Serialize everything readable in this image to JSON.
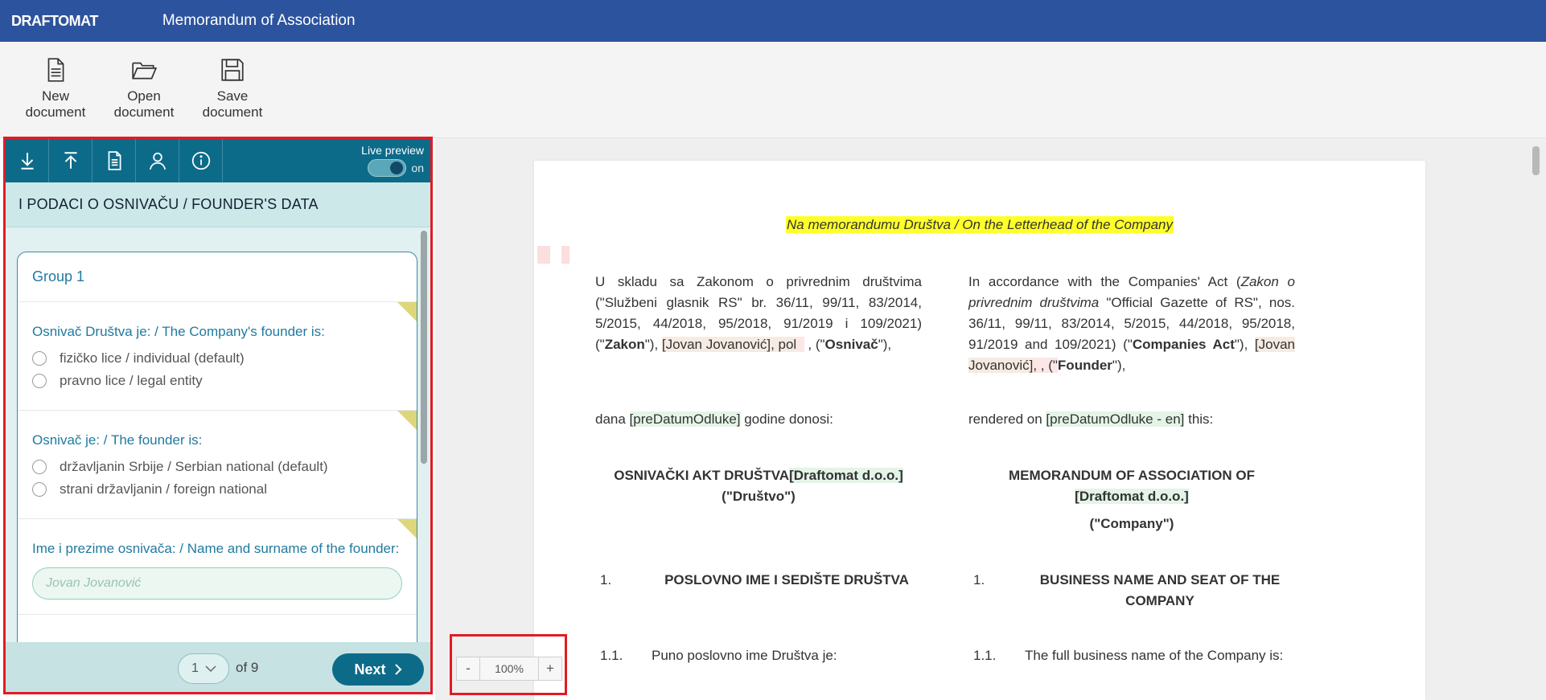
{
  "app": {
    "logo": "DRAFTOMAT",
    "title": "Memorandum of Association"
  },
  "toolbar": {
    "new_label": "New\ndocument",
    "open_label": "Open\ndocument",
    "save_label": "Save\ndocument"
  },
  "panel": {
    "tools": [
      "download-icon",
      "upload-icon",
      "document-icon",
      "user-icon",
      "info-icon"
    ],
    "live_preview_label": "Live preview",
    "live_preview_state": "on",
    "section_title": "I PODACI O OSNIVAČU / FOUNDER'S DATA",
    "group_title": "Group 1",
    "q1": {
      "label": "Osnivač Društva je: / The Company's founder is:",
      "options": [
        "fizičko lice / individual (default)",
        "pravno lice / legal entity"
      ]
    },
    "q2": {
      "label": "Osnivač je: / The founder is:",
      "options": [
        "državljanin Srbije / Serbian national (default)",
        "strani državljanin / foreign national"
      ]
    },
    "q3": {
      "label": "Ime i prezime osnivača: / Name and surname of the founder:",
      "placeholder": "Jovan Jovanović"
    },
    "pager": {
      "current": "1",
      "of_text": "of 9",
      "next_label": "Next"
    }
  },
  "zoom": {
    "minus": "-",
    "value": "100%",
    "plus": "+"
  },
  "document": {
    "letterhead": "Na memorandumu Društva / On the Letterhead of the Company",
    "left": {
      "p1_a": "U skladu sa Zakonom o privrednim društvima (\"Službeni glasnik RS\" br. 36/11, 99/11, 83/2014, 5/2015, 44/2018, 95/2018, 91/2019 i 109/2021) (\"",
      "p1_b": "Zakon",
      "p1_c": "\"), ",
      "p1_name": "[Jovan Jovanović]",
      "p1_d": ", pol",
      "p1_e": " , (\"",
      "p1_f": "Osnivač",
      "p1_g": "\"),",
      "p2_a": "dana ",
      "p2_date": "[preDatumOdluke]",
      "p2_b": " godine donosi:",
      "h1_a": "OSNIVAČKI AKT DRUŠTVA",
      "h1_company": "[Draftomat d.o.o.]",
      "h1_b": "(\"Društvo\")",
      "s1_num": "1.",
      "s1_title": "POSLOVNO IME I SEDIŠTE DRUŠTVA",
      "s11_num": "1.1.",
      "s11_text": "Puno poslovno ime Društva je:"
    },
    "right": {
      "p1_a": "In accordance with the Companies' Act (",
      "p1_italic": "Zakon o privrednim društvima",
      "p1_b": " \"Official Gazette of RS\", nos. 36/11, 99/11, 83/2014, 5/2015, 44/2018, 95/2018, 91/2019 and 109/2021) (\"",
      "p1_c": "Companies Act",
      "p1_d": "\"), ",
      "p1_name": "[Jovan Jovanović]",
      "p1_e": ", , (\"",
      "p1_f": "Founder",
      "p1_g": "\"),",
      "p2_a": "rendered on ",
      "p2_date": "[preDatumOdluke - en]",
      "p2_b": " this:",
      "h1_a": "MEMORANDUM OF ASSOCIATION OF",
      "h1_company": "[Draftomat d.o.o.]",
      "h1_b": "(\"Company\")",
      "s1_num": "1.",
      "s1_title": "BUSINESS NAME AND SEAT OF THE COMPANY",
      "s11_num": "1.1.",
      "s11_text": "The full business name of the Company is:"
    }
  }
}
